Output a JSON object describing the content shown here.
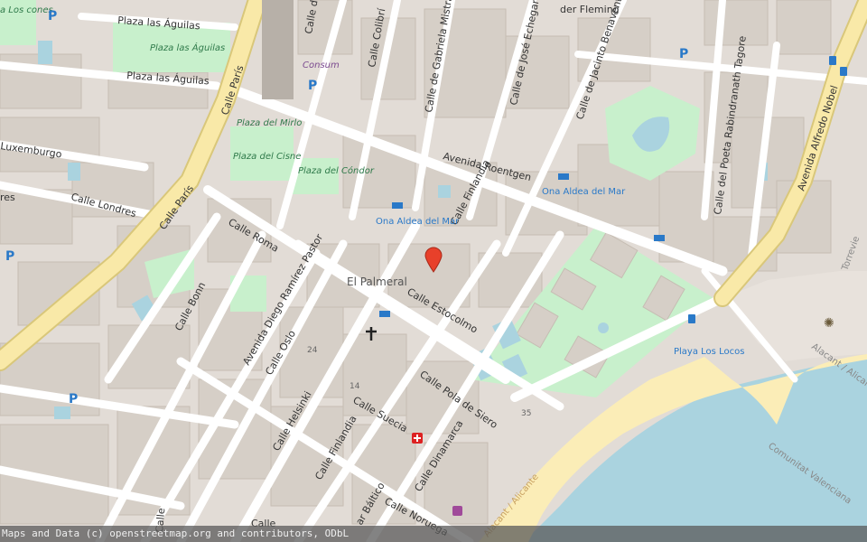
{
  "streets": {
    "plaza_aguilas_top": "Plaza las Águilas",
    "plaza_aguilas_mid": "Plaza las Águilas",
    "calle_paris_top": "Calle París",
    "calle_paris_low": "Calle París",
    "luxemburgo": "Luxemburgo",
    "calle_londres": "Calle Londres",
    "calle_londres_left": "res",
    "calle_roma": "Calle Roma",
    "calle_bonn": "Calle Bonn",
    "avenida_diego": "Avenida Diego Ramírez Pastor",
    "calle_oslo": "Calle Oslo",
    "calle_helsinki": "Calle Helsinki",
    "calle_finlandia_low": "Calle Finlandia",
    "calle_finlandia_up": "Calle Finlandia",
    "calle_estocolmo": "Calle Estocolmo",
    "calle_suecia": "Calle Suecia",
    "calle_pola": "Calle Pola de Siero",
    "calle_dinamarca": "Calle Dinamarca",
    "calle_noruega": "Calle Noruega",
    "mar_baltico": "ar Báltico",
    "calle_colibri": "Calle Colibrí",
    "calle_gabriela": "Calle de Gabriela Mistral",
    "calle_jose": "Calle de José Echegaray",
    "calle_fleming": "der Fleming",
    "calle_jacinto": "Calle de Jacinto Benavente",
    "avenida_roentgen": "Avenida Roentgen",
    "calle_tagore": "Calle del Poeta Rabindranath Tagore",
    "avenida_nobel": "Avenida Alfredo Nobel",
    "calle_de_top": "Calle de",
    "calle_bottom_left": "Calle",
    "calle_bottom2": "Calle"
  },
  "places": {
    "el_palmeral": "El Palmeral",
    "plaza_aguilas_green": "Plaza las Águilas",
    "plaza_mirlo": "Plaza del Mirlo",
    "plaza_cisne": "Plaza del Cisne",
    "plaza_condor": "Plaza del Cóndor",
    "los_cones": "a Los cones",
    "consum": "Consum",
    "ona_aldea_1": "Ona Aldea del Mar",
    "ona_aldea_2": "Ona Aldea del Mar",
    "playa_locos": "Playa Los Locos",
    "coast_1": "Alacant / Alicante",
    "coast_2": "Alacant / Alicante",
    "comunitat": "Comunitat Valenciana",
    "torrevieja": "Torrevie"
  },
  "numbers": {
    "n24": "24",
    "n14": "14",
    "n35": "35"
  },
  "attribution": "Maps and Data (c) openstreetmap.org and contributors, ODbL",
  "colors": {
    "land": "#e2dcd6",
    "building": "#d6cfc7",
    "building_edge": "#c6bdb3",
    "main_road": "#f9e9a8",
    "main_road_edge": "#d9c77a",
    "street": "#ffffff",
    "park": "#c8f0cc",
    "water": "#aad3df",
    "beach": "#fbedb7",
    "marker": "#e8402a"
  },
  "icons": [
    "parking-icon",
    "bus-stop-icon",
    "hotel-icon",
    "church-icon",
    "pharmacy-icon",
    "location-marker-icon"
  ]
}
